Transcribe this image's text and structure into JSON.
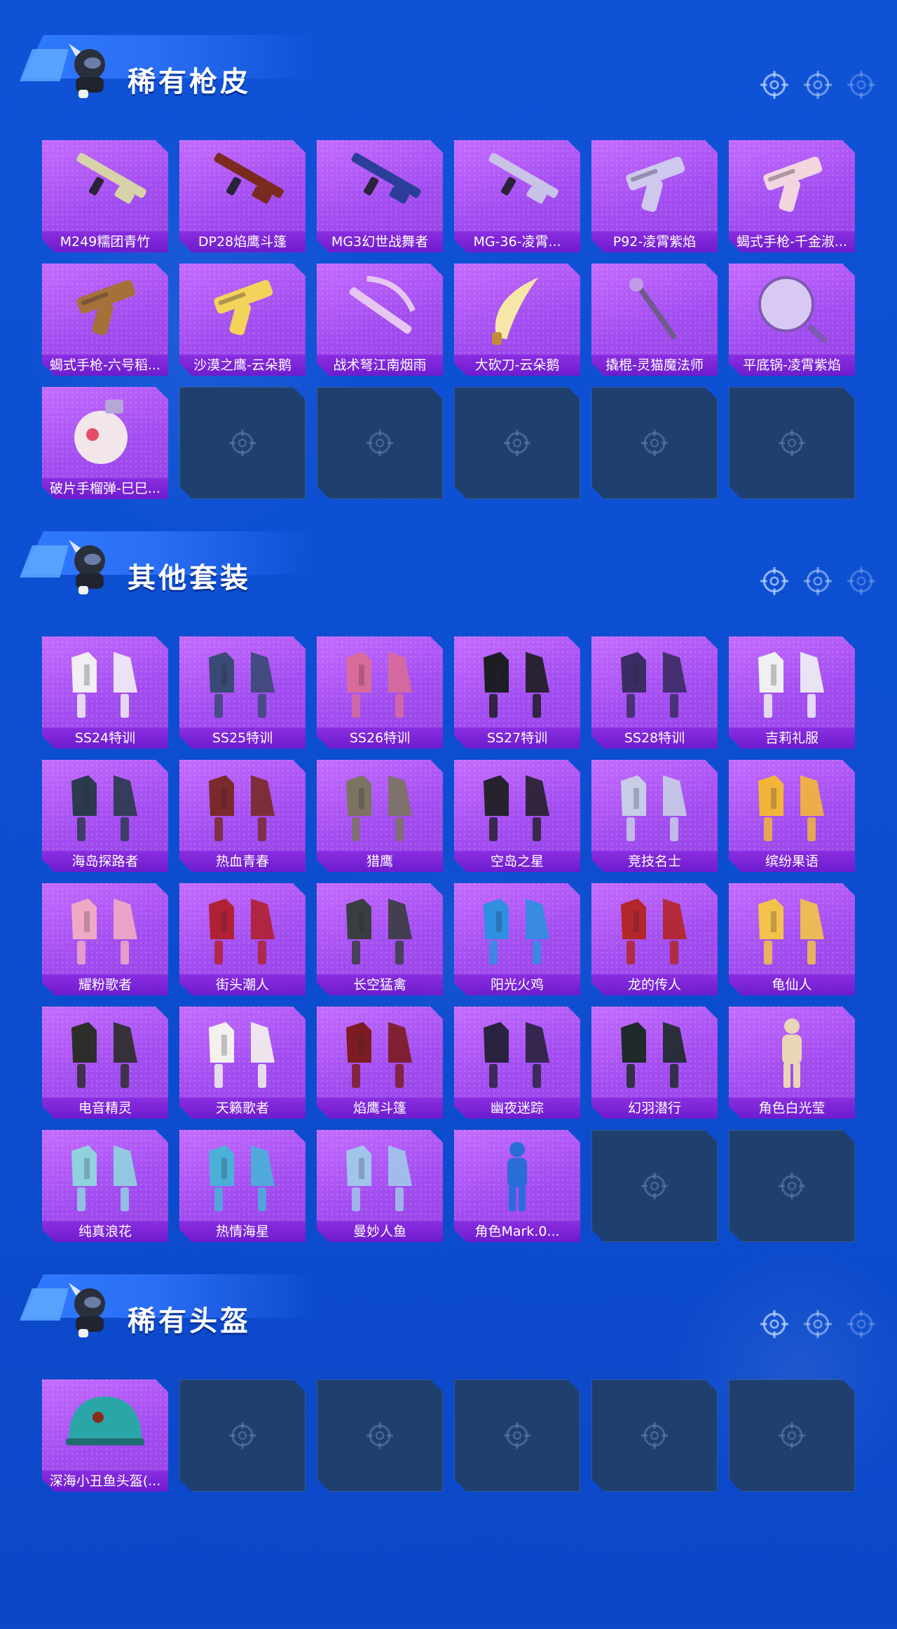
{
  "sections": [
    {
      "title": "稀有枪皮",
      "items": [
        {
          "label": "M249糯团青竹",
          "icon": "machine-gun-icon",
          "color": "#d8d2a8"
        },
        {
          "label": "DP28焰鹰斗篷",
          "icon": "machine-gun-icon",
          "color": "#7a2a1e"
        },
        {
          "label": "MG3幻世战舞者",
          "icon": "machine-gun-icon",
          "color": "#2b3f9a"
        },
        {
          "label": "MG-36-凌霄...",
          "icon": "rifle-icon",
          "color": "#c9c3e8"
        },
        {
          "label": "P92-凌霄紫焰",
          "icon": "pistol-icon",
          "color": "#cfc8ee"
        },
        {
          "label": "蝎式手枪-千金淑...",
          "icon": "smg-icon",
          "color": "#f1d6df"
        },
        {
          "label": "蝎式手枪-六号稻...",
          "icon": "smg-icon",
          "color": "#a5713a"
        },
        {
          "label": "沙漠之鹰-云朵鹅",
          "icon": "pistol-icon",
          "color": "#f3d35a"
        },
        {
          "label": "战术弩江南烟雨",
          "icon": "crossbow-icon",
          "color": "#e6c6f0"
        },
        {
          "label": "大砍刀-云朵鹅",
          "icon": "machete-icon",
          "color": "#f6e7a8"
        },
        {
          "label": "撬棍-灵猫魔法师",
          "icon": "crowbar-icon",
          "color": "#c39be6"
        },
        {
          "label": "平底锅-凌霄紫焰",
          "icon": "pan-icon",
          "color": "#d8c9f2"
        },
        {
          "label": "破片手榴弹-巳巳...",
          "icon": "grenade-icon",
          "color": "#f2e6ea"
        }
      ],
      "empty_count": 5
    },
    {
      "title": "其他套装",
      "items": [
        {
          "label": "SS24特训",
          "icon": "outfit-icon",
          "color": "#f1eef4"
        },
        {
          "label": "SS25特训",
          "icon": "outfit-icon",
          "color": "#3a4a76"
        },
        {
          "label": "SS26特训",
          "icon": "outfit-icon",
          "color": "#d86b9a"
        },
        {
          "label": "SS27特训",
          "icon": "outfit-icon",
          "color": "#1d1d24"
        },
        {
          "label": "SS28特训",
          "icon": "outfit-icon",
          "color": "#3b2c64"
        },
        {
          "label": "吉莉礼服",
          "icon": "outfit-icon",
          "color": "#eef0f2"
        },
        {
          "label": "海岛探路者",
          "icon": "outfit-icon",
          "color": "#2c3a4e"
        },
        {
          "label": "热血青春",
          "icon": "outfit-icon",
          "color": "#7a2a2a"
        },
        {
          "label": "猎鹰",
          "icon": "outfit-icon",
          "color": "#7b7360"
        },
        {
          "label": "空岛之星",
          "icon": "outfit-icon",
          "color": "#26222e"
        },
        {
          "label": "竞技名士",
          "icon": "outfit-icon",
          "color": "#c7cde6"
        },
        {
          "label": "缤纷果语",
          "icon": "outfit-icon",
          "color": "#f2b53a"
        },
        {
          "label": "耀粉歌者",
          "icon": "outfit-icon",
          "color": "#f0a9c4"
        },
        {
          "label": "街头潮人",
          "icon": "outfit-icon",
          "color": "#b02233"
        },
        {
          "label": "长空猛禽",
          "icon": "outfit-icon",
          "color": "#3a3d42"
        },
        {
          "label": "阳光火鸡",
          "icon": "outfit-icon",
          "color": "#2f8fe0"
        },
        {
          "label": "龙的传人",
          "icon": "outfit-icon",
          "color": "#b3262a"
        },
        {
          "label": "龟仙人",
          "icon": "outfit-icon",
          "color": "#f3c24a"
        },
        {
          "label": "电音精灵",
          "icon": "outfit-icon",
          "color": "#2c2e2a"
        },
        {
          "label": "天籁歌者",
          "icon": "outfit-icon",
          "color": "#f3f1ee"
        },
        {
          "label": "焰鹰斗篷",
          "icon": "outfit-icon",
          "color": "#7c1c22"
        },
        {
          "label": "幽夜迷踪",
          "icon": "outfit-icon",
          "color": "#2a2340"
        },
        {
          "label": "幻羽潜行",
          "icon": "outfit-icon",
          "color": "#1f2a2a"
        },
        {
          "label": "角色白光莹",
          "icon": "character-icon",
          "color": "#e9d6b6"
        },
        {
          "label": "纯真浪花",
          "icon": "outfit-icon",
          "color": "#8fd2de"
        },
        {
          "label": "热情海星",
          "icon": "outfit-icon",
          "color": "#4ab0d8"
        },
        {
          "label": "曼妙人鱼",
          "icon": "outfit-icon",
          "color": "#9fc6ea"
        },
        {
          "label": "角色Mark.0...",
          "icon": "character-icon",
          "color": "#2b6dd8"
        }
      ],
      "empty_count": 2
    },
    {
      "title": "稀有头盔",
      "items": [
        {
          "label": "深海小丑鱼头盔(...",
          "icon": "helmet-icon",
          "color": "#2aa6a8"
        }
      ],
      "empty_count": 5
    }
  ]
}
